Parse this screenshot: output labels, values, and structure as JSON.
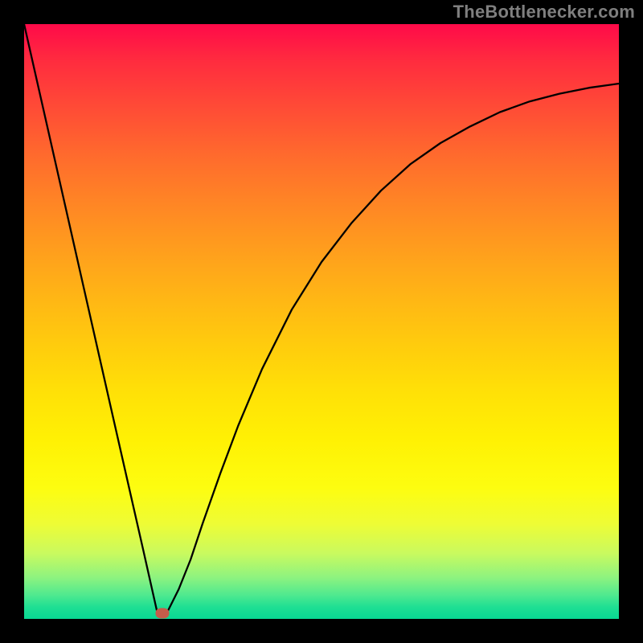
{
  "watermark": {
    "text": "TheBottlenecker.com"
  },
  "colors": {
    "frame": "#000000",
    "curve": "#000000",
    "marker": "#c55c4a",
    "watermark": "#7f7f7f"
  },
  "chart_data": {
    "type": "line",
    "title": "",
    "xlabel": "",
    "ylabel": "",
    "xlim": [
      0,
      1
    ],
    "ylim": [
      0,
      1
    ],
    "legend": false,
    "grid": false,
    "annotations": [
      "TheBottlenecker.com"
    ],
    "series": [
      {
        "name": "bottleneck-curve",
        "x": [
          0.0,
          0.05,
          0.1,
          0.15,
          0.2,
          0.224,
          0.24,
          0.26,
          0.28,
          0.3,
          0.33,
          0.36,
          0.4,
          0.45,
          0.5,
          0.55,
          0.6,
          0.65,
          0.7,
          0.75,
          0.8,
          0.85,
          0.9,
          0.95,
          1.0
        ],
        "y": [
          1.0,
          0.779,
          0.558,
          0.337,
          0.117,
          0.01,
          0.01,
          0.05,
          0.1,
          0.16,
          0.245,
          0.325,
          0.42,
          0.52,
          0.6,
          0.665,
          0.72,
          0.765,
          0.8,
          0.828,
          0.852,
          0.87,
          0.883,
          0.893,
          0.9
        ]
      }
    ],
    "marker": {
      "x": 0.232,
      "y": 0.01
    },
    "background_gradient": {
      "direction": "vertical",
      "stops": [
        {
          "pos": 0.0,
          "color": "#ff0a49"
        },
        {
          "pos": 0.5,
          "color": "#ffc40f"
        },
        {
          "pos": 0.8,
          "color": "#f8fc18"
        },
        {
          "pos": 1.0,
          "color": "#08d893"
        }
      ]
    }
  }
}
